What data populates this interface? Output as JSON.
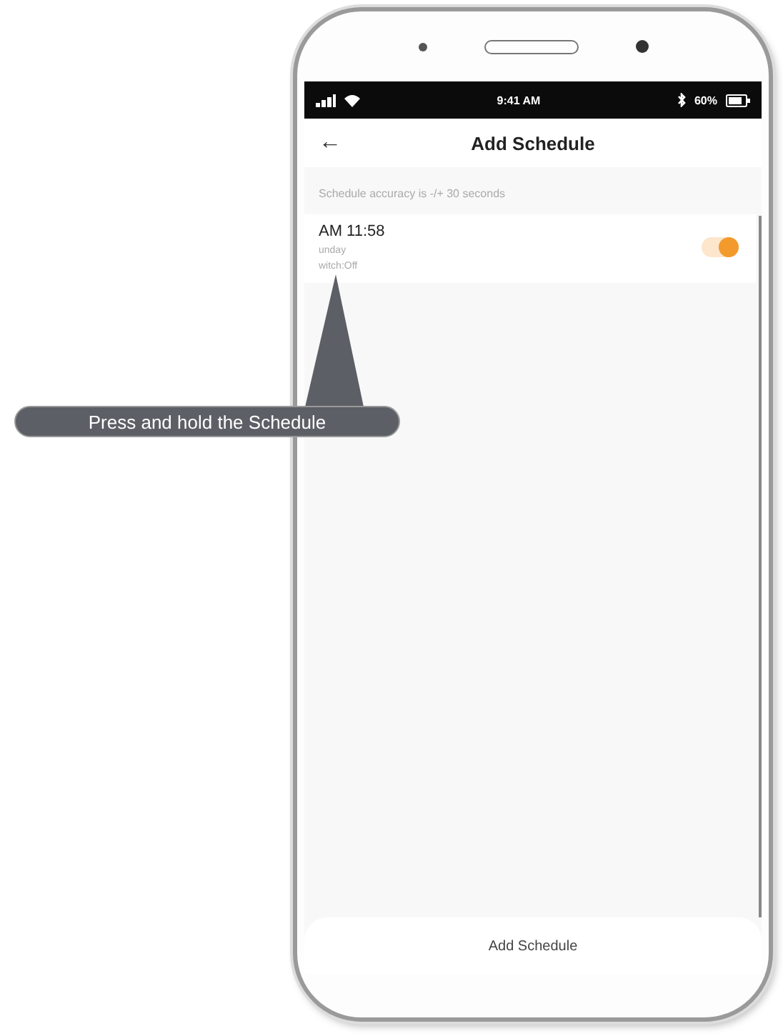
{
  "status_bar": {
    "time": "9:41 AM",
    "battery": "60%"
  },
  "header": {
    "back": "←",
    "title": "Add Schedule"
  },
  "notice": "Schedule accuracy is -/+ 30 seconds",
  "schedules": [
    {
      "time": "AM 11:58",
      "days": "unday",
      "action": "witch:Off",
      "on": true
    }
  ],
  "bottom_button": "Add Schedule",
  "callout": "Press and hold the Schedule"
}
